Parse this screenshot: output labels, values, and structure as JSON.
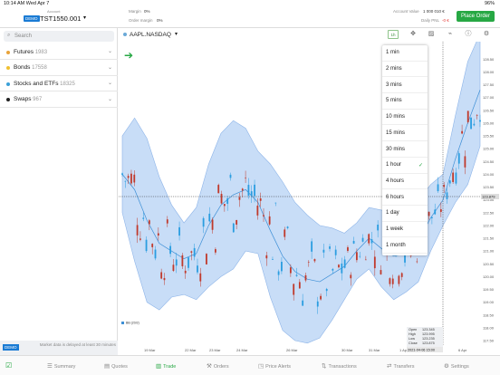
{
  "status_bar": {
    "time_date": "10:14 AM  Wed Apr 7",
    "battery": "96%"
  },
  "account": {
    "label": "Account",
    "badge": "DEMO",
    "name": "TST1550.001",
    "margin_label": "Margin",
    "margin_value": "0%",
    "order_margin_label": "Order margin",
    "order_margin_value": "0%",
    "value_label": "Account Value",
    "value": "1 000 010 €",
    "pnl_label": "Daily PNL",
    "pnl_value": "-0 €",
    "place_order": "Place Order"
  },
  "sidebar": {
    "search_placeholder": "Search",
    "categories": [
      {
        "name": "Futures",
        "count": "1983",
        "color": "#e8a33a"
      },
      {
        "name": "Bonds",
        "count": "17558",
        "color": "#f0c030"
      },
      {
        "name": "Stocks and ETFs",
        "count": "18325",
        "color": "#3aa0d8"
      },
      {
        "name": "Swaps",
        "count": "967",
        "color": "#222222"
      }
    ],
    "footer_badge": "DEMO",
    "footer_message": "Market data is delayed at least 30 minutes"
  },
  "chart_toolbar": {
    "symbol": "AAPL.NASDAQ",
    "timeframe": "1h"
  },
  "timeframes": [
    "1 min",
    "2 mins",
    "3 mins",
    "5 mins",
    "10 mins",
    "15 mins",
    "30 mins",
    "1 hour",
    "4 hours",
    "6 hours",
    "1 day",
    "1 week",
    "1 month"
  ],
  "selected_timeframe": "1 hour",
  "chart_data": {
    "type": "candlestick",
    "y_ticks": [
      "128.50",
      "128.00",
      "127.50",
      "127.00",
      "126.50",
      "126.00",
      "125.50",
      "125.00",
      "124.50",
      "124.00",
      "123.50",
      "123.00",
      "122.50",
      "122.00",
      "121.50",
      "121.00",
      "120.50",
      "120.00",
      "119.50",
      "119.00",
      "118.50",
      "118.00",
      "117.50"
    ],
    "ylim": [
      117.5,
      128.9
    ],
    "x_ticks": [
      "19 Mar",
      "22 Mar",
      "23 Mar",
      "24 Mar",
      "26 Mar",
      "30 Mar",
      "31 Mar",
      "1 Apr",
      "6 Apr"
    ],
    "crosshair_x_label": "2021-04-06 15:00",
    "crosshair_price_label": "123.879",
    "legend_label": "BB (20/2)",
    "ohlc": {
      "open": "123.345",
      "high": "123.995",
      "low": "123.235",
      "close": "123.875"
    },
    "colors": {
      "band": "#b5d1f4",
      "mid": "#3d8fd6",
      "up": "#2a9de0",
      "down": "#c0392b"
    }
  },
  "tabs": [
    "Summary",
    "Quotes",
    "Trade",
    "Orders",
    "Price Alerts",
    "Transactions",
    "Transfers",
    "Settings"
  ],
  "active_tab": "Trade"
}
